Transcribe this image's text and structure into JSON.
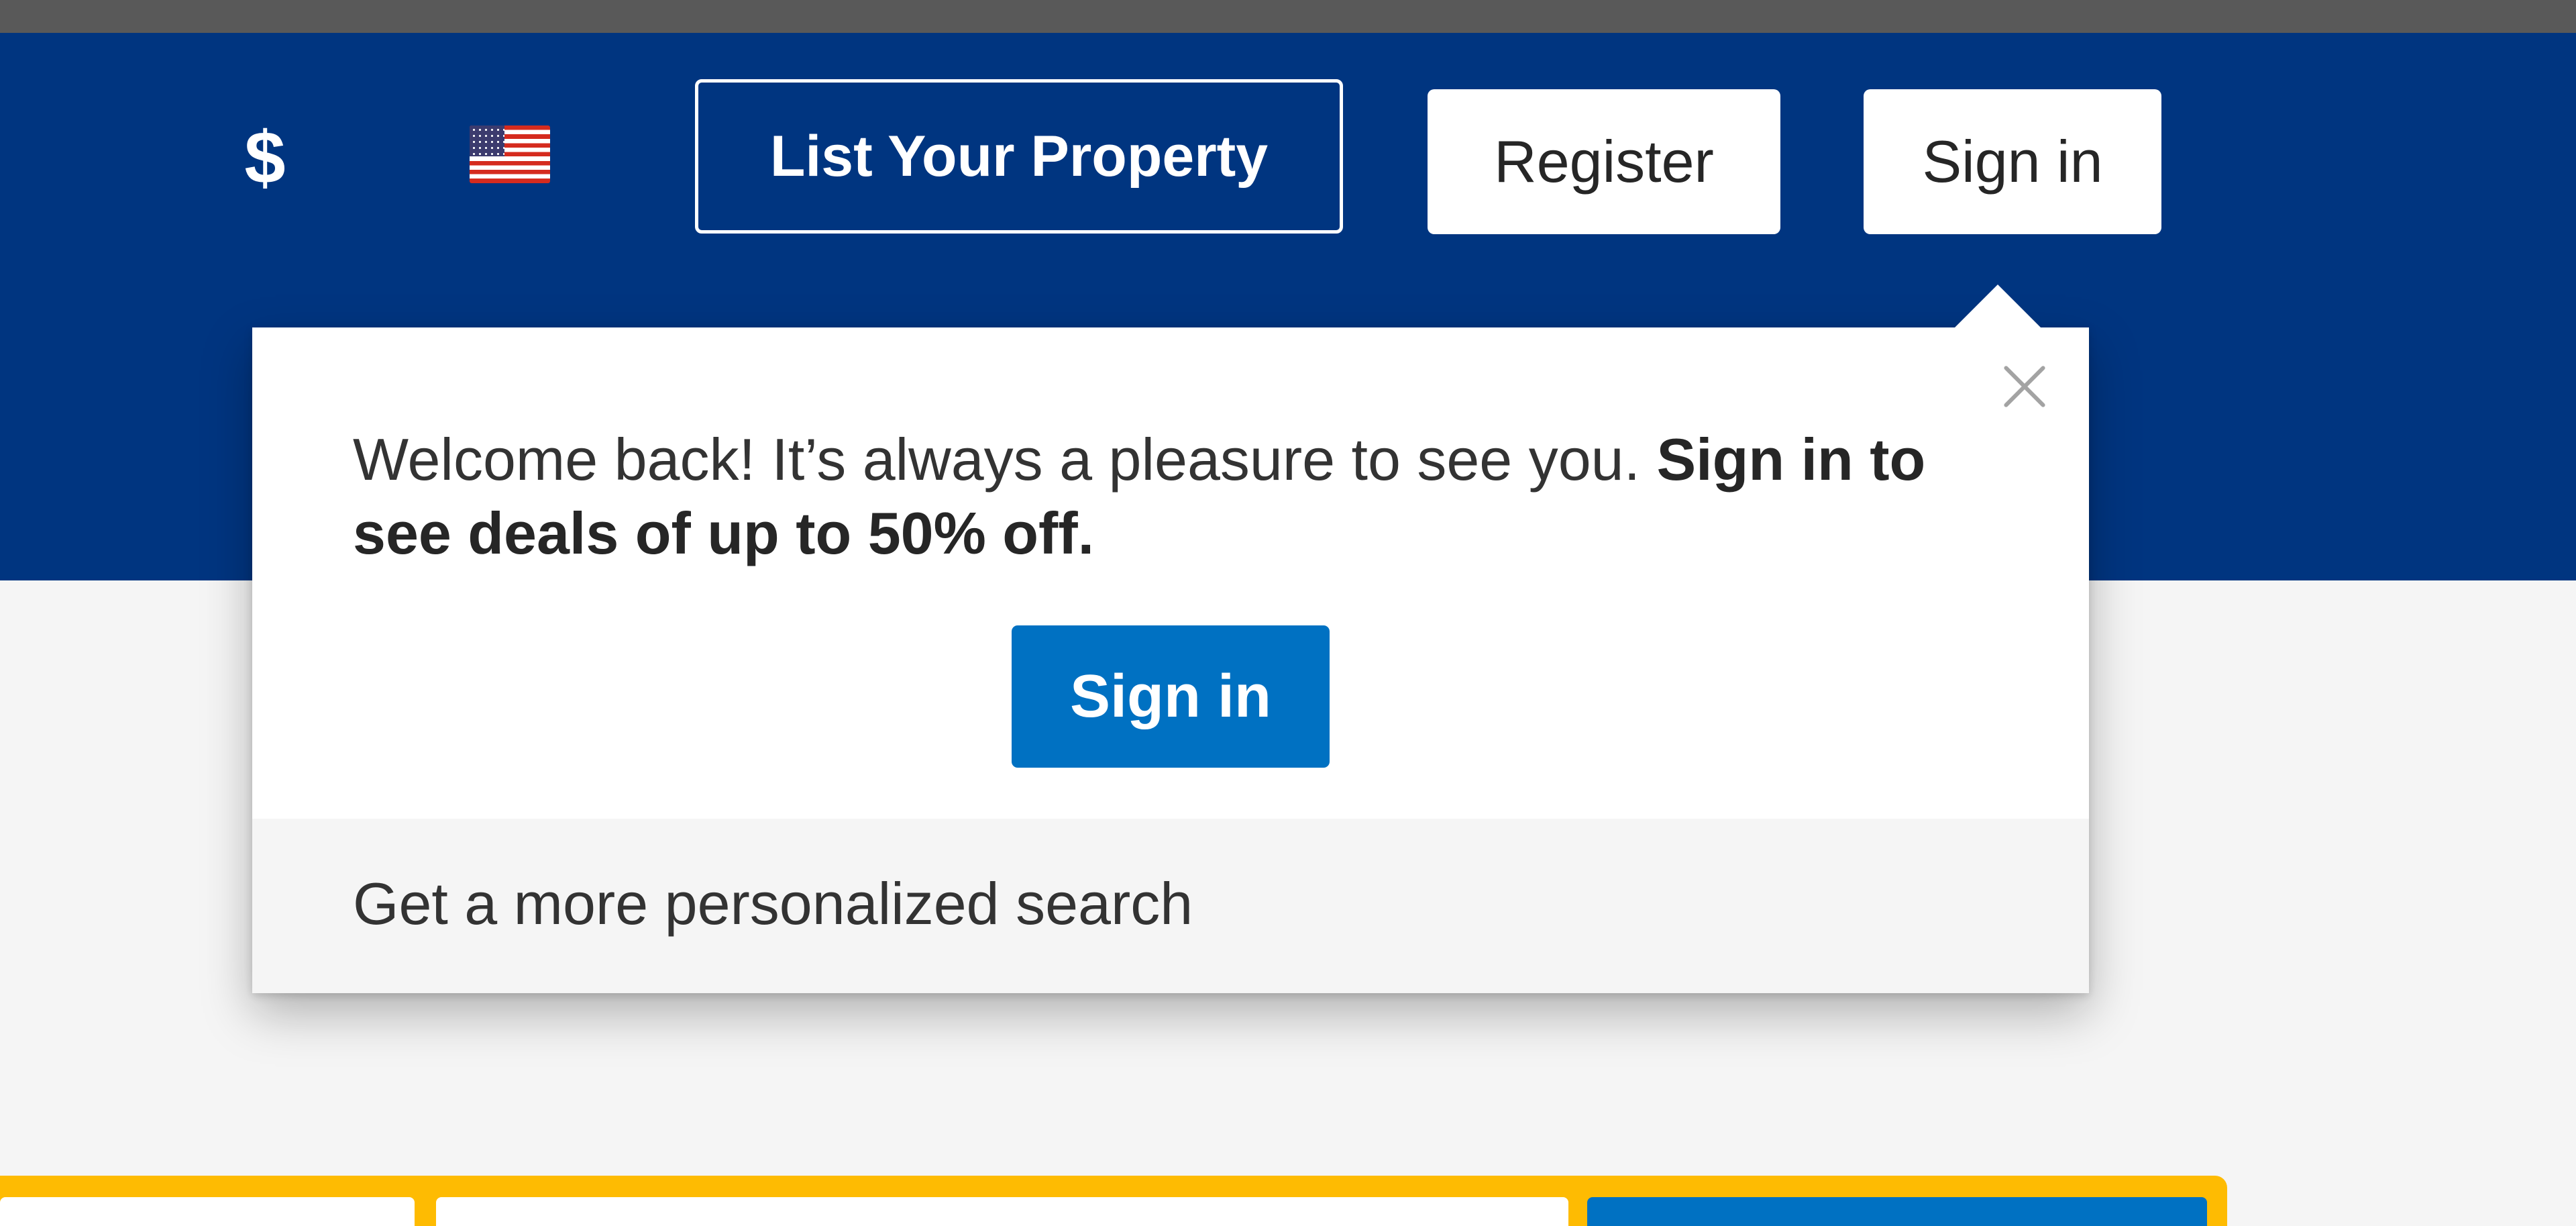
{
  "header": {
    "currency_symbol": "$",
    "language_icon": "us-flag-icon",
    "list_property_label": "List Your Property",
    "register_label": "Register",
    "signin_label": "Sign in"
  },
  "signin_popover": {
    "message_regular": "Welcome back! It’s always a pleasure to see you.",
    "message_bold": "Sign in to see deals of up to 50% off.",
    "signin_button_label": "Sign in",
    "footer_text": "Get a more personalized search",
    "close_icon": "close-icon"
  },
  "colors": {
    "header_background": "#003580",
    "primary_button": "#0071c2",
    "search_border": "#febb02",
    "page_background": "#f5f5f5"
  }
}
